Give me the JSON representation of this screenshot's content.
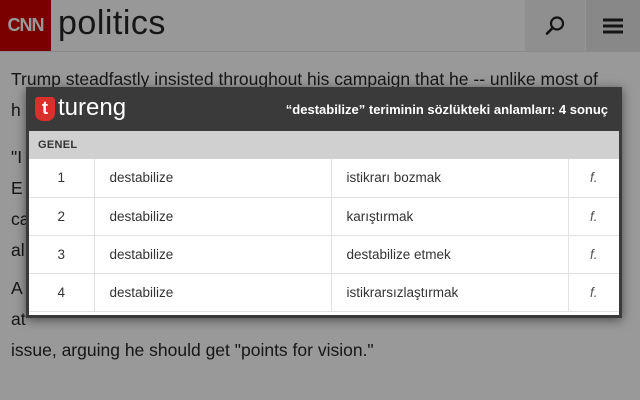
{
  "site": {
    "logo_text": "CNN",
    "section": "politics",
    "search_icon": "search-icon",
    "menu_icon": "hamburger-menu-icon"
  },
  "article": {
    "lines": [
      "Trump steadfastly insisted throughout his campaign that he -- unlike most of",
      "h",
      "\"I",
      "E",
      "ca",
      "al",
      "A",
      "at",
      "issue, arguing he should get \"points for vision.\""
    ]
  },
  "popup": {
    "brand_letter": "t",
    "brand": "tureng",
    "summary": "“destabilize” teriminin sözlükteki anlamları: 4 sonuç",
    "category": "GENEL",
    "rows": [
      {
        "n": "1",
        "term": "destabilize",
        "meaning": "istikrarı bozmak",
        "pos": "f."
      },
      {
        "n": "2",
        "term": "destabilize",
        "meaning": "karıştırmak",
        "pos": "f."
      },
      {
        "n": "3",
        "term": "destabilize",
        "meaning": "destabilize etmek",
        "pos": "f."
      },
      {
        "n": "4",
        "term": "destabilize",
        "meaning": "istikrarsızlaştırmak",
        "pos": "f."
      }
    ],
    "colors": {
      "logo_red": "#d9302b",
      "header_bg": "#3a3a3a",
      "category_bg": "#d0d0d0"
    }
  },
  "colors": {
    "cnn_red": "#cc0000"
  }
}
